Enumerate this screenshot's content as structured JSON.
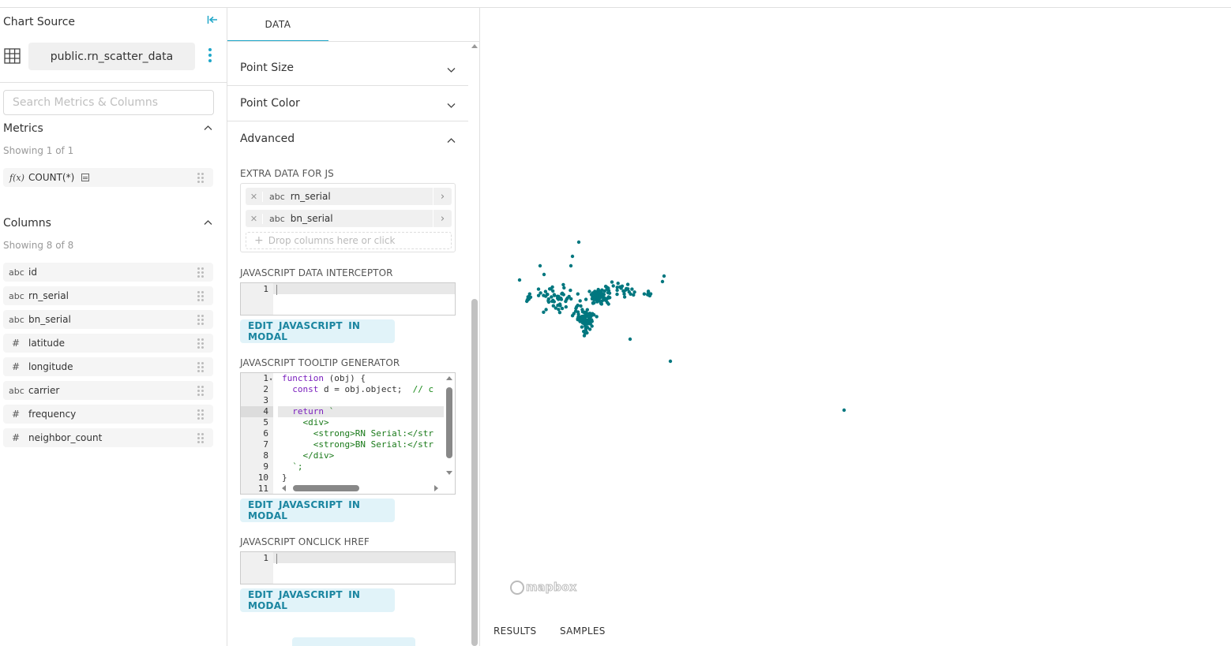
{
  "chart_source": {
    "title": "Chart Source",
    "datasource": "public.rn_scatter_data",
    "search_placeholder": "Search Metrics & Columns"
  },
  "metrics": {
    "title": "Metrics",
    "showing": "Showing 1 of 1",
    "items": [
      {
        "type": "f(x)",
        "label": "COUNT(*)"
      }
    ]
  },
  "columns": {
    "title": "Columns",
    "showing": "Showing 8 of 8",
    "items": [
      {
        "type": "abc",
        "label": "id"
      },
      {
        "type": "abc",
        "label": "rn_serial"
      },
      {
        "type": "abc",
        "label": "bn_serial"
      },
      {
        "type": "#",
        "label": "latitude"
      },
      {
        "type": "#",
        "label": "longitude"
      },
      {
        "type": "abc",
        "label": "carrier"
      },
      {
        "type": "#",
        "label": "frequency"
      },
      {
        "type": "#",
        "label": "neighbor_count"
      }
    ]
  },
  "panel": {
    "tab": "DATA",
    "sections": [
      "Point Size",
      "Point Color",
      "Advanced"
    ],
    "extra_data": {
      "label": "EXTRA DATA FOR JS",
      "items": [
        {
          "type": "abc",
          "label": "rn_serial"
        },
        {
          "type": "abc",
          "label": "bn_serial"
        }
      ],
      "drop_placeholder": "Drop columns here or click"
    },
    "interceptor": {
      "label": "JAVASCRIPT DATA INTERCEPTOR",
      "line": "1"
    },
    "tooltip": {
      "label": "JAVASCRIPT TOOLTIP GENERATOR",
      "line_numbers": [
        "1",
        "2",
        "3",
        "4",
        "5",
        "6",
        "7",
        "8",
        "9",
        "10",
        "11"
      ],
      "code": {
        "l1_kw": "function",
        "l1_rest": " (obj) {",
        "l2_kw": "  const",
        "l2_rest": " d = obj.object;  ",
        "l2_cm": "// c",
        "l4_kw": "  return",
        "l4_rest": " `",
        "l5": "    <div>",
        "l6": "      <strong>RN Serial:</str",
        "l7": "      <strong>BN Serial:</str",
        "l8": "    </div>",
        "l9": "  `;",
        "l10": "}"
      }
    },
    "onclick": {
      "label": "JAVASCRIPT ONCLICK HREF",
      "line": "1"
    },
    "edit_button": "EDIT  JAVASCRIPT  IN MODAL"
  },
  "map": {
    "attribution": "mapbox",
    "point_color": "#00777f",
    "tabs": [
      "RESULTS",
      "SAMPLES"
    ]
  }
}
